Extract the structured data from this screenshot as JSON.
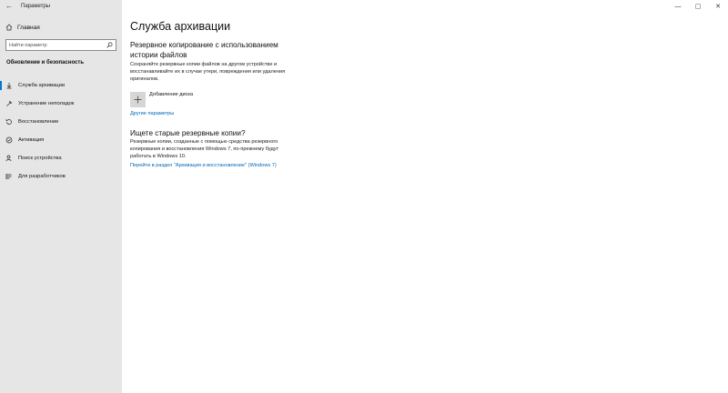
{
  "window": {
    "title": "Параметры",
    "back_icon": "back-arrow-icon",
    "controls": [
      "minimize",
      "maximize",
      "close"
    ]
  },
  "sidebar": {
    "home_label": "Главная",
    "search_placeholder": "Найти параметр",
    "section_title": "Обновление и безопасность",
    "items": [
      {
        "label": "Служба архивации",
        "icon": "backup-arrow-icon",
        "selected": true
      },
      {
        "label": "Устранение неполадок",
        "icon": "wrench-icon",
        "selected": false
      },
      {
        "label": "Восстановление",
        "icon": "recovery-icon",
        "selected": false
      },
      {
        "label": "Активация",
        "icon": "check-circle-icon",
        "selected": false
      },
      {
        "label": "Поиск устройства",
        "icon": "person-location-icon",
        "selected": false
      },
      {
        "label": "Для разработчиков",
        "icon": "developer-icon",
        "selected": false
      }
    ]
  },
  "main": {
    "title": "Служба архивации",
    "history": {
      "heading_line1": "Резервное копирование с использованием",
      "heading_line2": "истории файлов",
      "desc_line1": "Сохраняйте резервные копии файлов на другом устройстве и",
      "desc_line2": "восстанавливайте их в случае утери, повреждения или удаления",
      "desc_line3": "оригиналов.",
      "add_drive_label": "Добавление диска",
      "more_options_link": "Другие параметры"
    },
    "old_backups": {
      "heading": "Ищете старые резервные копии?",
      "desc_line1": "Резервные копии, созданные с помощью средства резервного",
      "desc_line2": "копирования и восстановления Windows 7, по-прежнему будут",
      "desc_line3": "работать в Windows 10.",
      "link": "Перейти в раздел \"Архивация и восстановление\" (Windows 7)"
    }
  },
  "colors": {
    "sidebar_bg": "#e6e6e6",
    "accent": "#0078d4",
    "link": "#0067b8"
  }
}
